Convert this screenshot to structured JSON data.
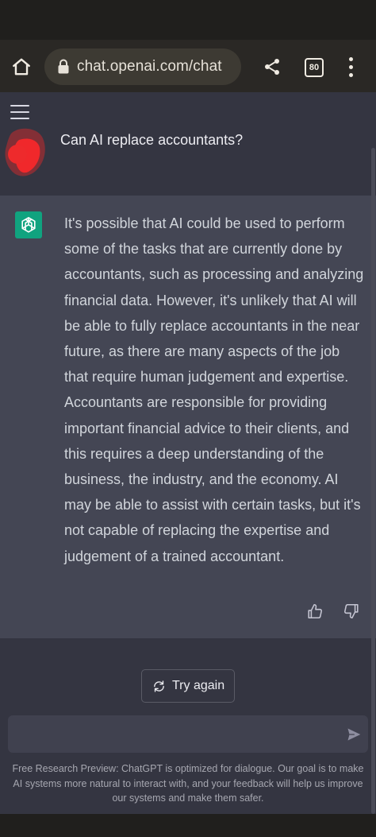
{
  "browser": {
    "url": "chat.openai.com/chat",
    "tab_count": "80"
  },
  "conversation": {
    "user_message": "Can AI replace accountants?",
    "assistant_message": "It's possible that AI could be used to perform some of the tasks that are currently done by accountants, such as processing and analyzing financial data. However, it's unlikely that AI will be able to fully replace accountants in the near future, as there are many aspects of the job that require human judgement and expertise. Accountants are responsible for providing important financial advice to their clients, and this requires a deep understanding of the business, the industry, and the economy. AI may be able to assist with certain tasks, but it's not capable of replacing the expertise and judgement of a trained accountant."
  },
  "actions": {
    "try_again_label": "Try again"
  },
  "composer": {
    "value": ""
  },
  "footer": {
    "note": "Free Research Preview: ChatGPT is optimized for dialogue. Our goal is to make AI systems more natural to interact with, and your feedback will help us improve our systems and make them safer."
  },
  "colors": {
    "page_bg": "#343541",
    "assistant_bg": "#444654",
    "brand_green": "#10a37f",
    "redaction_red": "#e8262a"
  },
  "icons": [
    "home-icon",
    "lock-icon",
    "share-icon",
    "tab-switcher-icon",
    "overflow-menu-icon",
    "hamburger-icon",
    "openai-logo-icon",
    "thumbs-up-icon",
    "thumbs-down-icon",
    "refresh-icon",
    "send-icon"
  ]
}
